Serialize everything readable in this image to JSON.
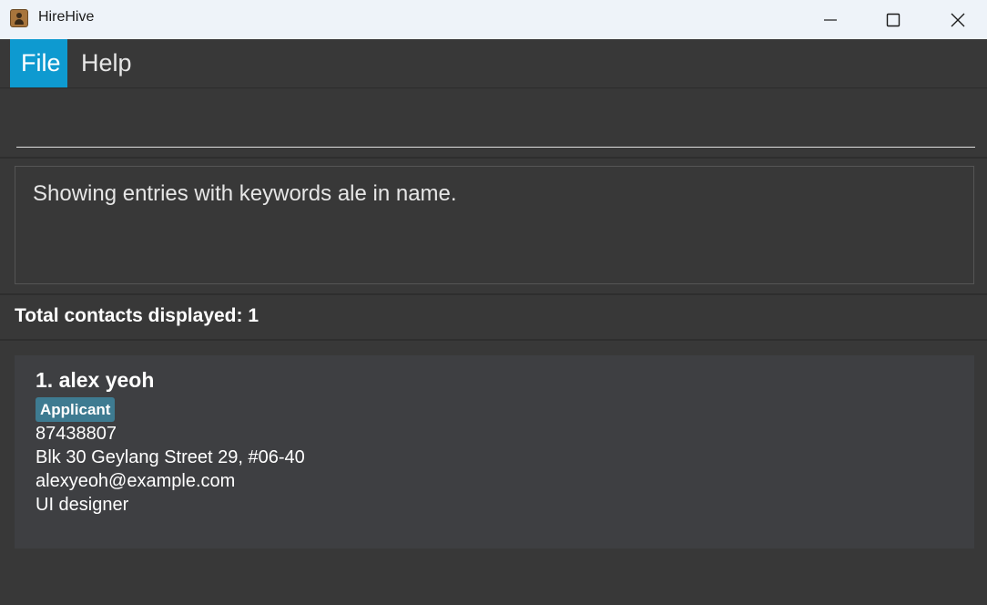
{
  "window": {
    "title": "HireHive"
  },
  "menu": {
    "file": "File",
    "help": "Help"
  },
  "command": {
    "value": "",
    "placeholder": ""
  },
  "result": {
    "message": "Showing entries with keywords ale in name."
  },
  "list": {
    "total_label": "Total contacts displayed: 1",
    "contacts": [
      {
        "name": "1. alex yeoh",
        "tag": "Applicant",
        "phone": "87438807",
        "address": "Blk 30 Geylang Street 29, #06-40",
        "email": "alexyeoh@example.com",
        "role": "UI designer"
      }
    ]
  },
  "colors": {
    "accent": "#0e9ad0",
    "tag": "#3e7b91",
    "background": "#383838"
  }
}
